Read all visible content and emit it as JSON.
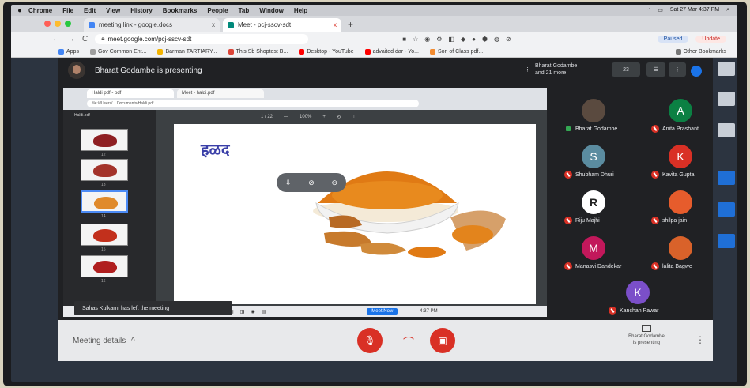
{
  "menubar": {
    "apple_icon": "apple-icon",
    "items": [
      "Chrome",
      "File",
      "Edit",
      "View",
      "History",
      "Bookmarks",
      "People",
      "Tab",
      "Window",
      "Help"
    ],
    "clock": "Sat 27 Mar 4:37 PM"
  },
  "tabs": [
    {
      "label": "meeting link - google.docs",
      "close": "x",
      "favicon_color": "#4285f4"
    },
    {
      "label": "Meet - pcj-sscv-sdt",
      "close": "x",
      "favicon_color": "#00897b"
    }
  ],
  "toolbar": {
    "back": "←",
    "forward": "→",
    "reload": "C",
    "url": "meet.google.com/pcj-sscv-sdt",
    "paused": "Paused",
    "update": "Update"
  },
  "bookmarks": {
    "items": [
      {
        "label": "Apps",
        "color": "#4285f4"
      },
      {
        "label": "Gov Common Ent...",
        "color": "#9e9e9e"
      },
      {
        "label": "Barman TARTIARY...",
        "color": "#f4b400"
      },
      {
        "label": "This Sb Shoptest B...",
        "color": "#db4437"
      },
      {
        "label": "Desktop - YouTube",
        "color": "#ff0000"
      },
      {
        "label": "advaited dar - Yo...",
        "color": "#ff0000"
      },
      {
        "label": "Son of Class pdf...",
        "color": "#f28b30"
      }
    ],
    "other": "Other Bookmarks"
  },
  "meet": {
    "presenting_text": "Bharat Godambe is presenting",
    "others_line1": "Bharat Godambe",
    "others_line2": "and 21 more",
    "ctrl1": "23",
    "ctrl2": "☰",
    "ctrl3": "⋮",
    "toast": "Sahas Kulkarni has left the meeting",
    "meeting_details": "Meeting details",
    "meeting_details_chevron": "^",
    "present_label_1": "Bharat Godambe",
    "present_label_2": "is presenting"
  },
  "shared_screen": {
    "tab1": "Haldi pdf - pdf",
    "tab2": "Meet - haldi.pdf",
    "url": "file:///Users/... Documents/Haldi pdf",
    "doc_title": "Haldi.pdf",
    "toolbar": [
      "1 / 22",
      "—",
      "100%",
      "+",
      "⟲",
      "⋮"
    ],
    "slide_title": "हळद",
    "pdf_controls": [
      "⇩",
      "⊘",
      "⊖"
    ],
    "slide_numbers": [
      "12",
      "13",
      "14",
      "15",
      "16"
    ],
    "taskbar_button": "Meet Now",
    "taskbar_time": "4:37 PM"
  },
  "participants": [
    {
      "name": "Bharat Godambe",
      "initial": "",
      "color": "#5a4a3f",
      "mic": "on"
    },
    {
      "name": "Anita Prashant",
      "initial": "A",
      "color": "#0b8043",
      "mic": "off"
    },
    {
      "name": "Shubham Dhuri",
      "initial": "S",
      "color": "#5b8ca0",
      "mic": "off"
    },
    {
      "name": "Kavita Gupta",
      "initial": "K",
      "color": "#d93025",
      "mic": "off"
    },
    {
      "name": "Riju Majhi",
      "initial": "R",
      "color": "#ffffff",
      "mic": "off"
    },
    {
      "name": "shilpa jain",
      "initial": "",
      "color": "#e65c2c",
      "mic": "off"
    },
    {
      "name": "Manasvi Dandekar",
      "initial": "M",
      "color": "#c2185b",
      "mic": "off"
    },
    {
      "name": "lalita Bagwe",
      "initial": "",
      "color": "#d9622a",
      "mic": "off"
    },
    {
      "name": "Kanchan Pawar",
      "initial": "K",
      "color": "#7b4fc9",
      "mic": "off"
    }
  ],
  "colors": {
    "meet_bg": "#202124",
    "accent_red": "#d93025",
    "accent_blue": "#1a73e8",
    "slide_title": "#3a3fa8"
  },
  "icons": {
    "mic_off": "mic-off-icon",
    "cam_off": "camera-off-icon",
    "hangup": "hang-up-icon",
    "present": "present-screen-icon",
    "more": "more-vert-icon"
  }
}
